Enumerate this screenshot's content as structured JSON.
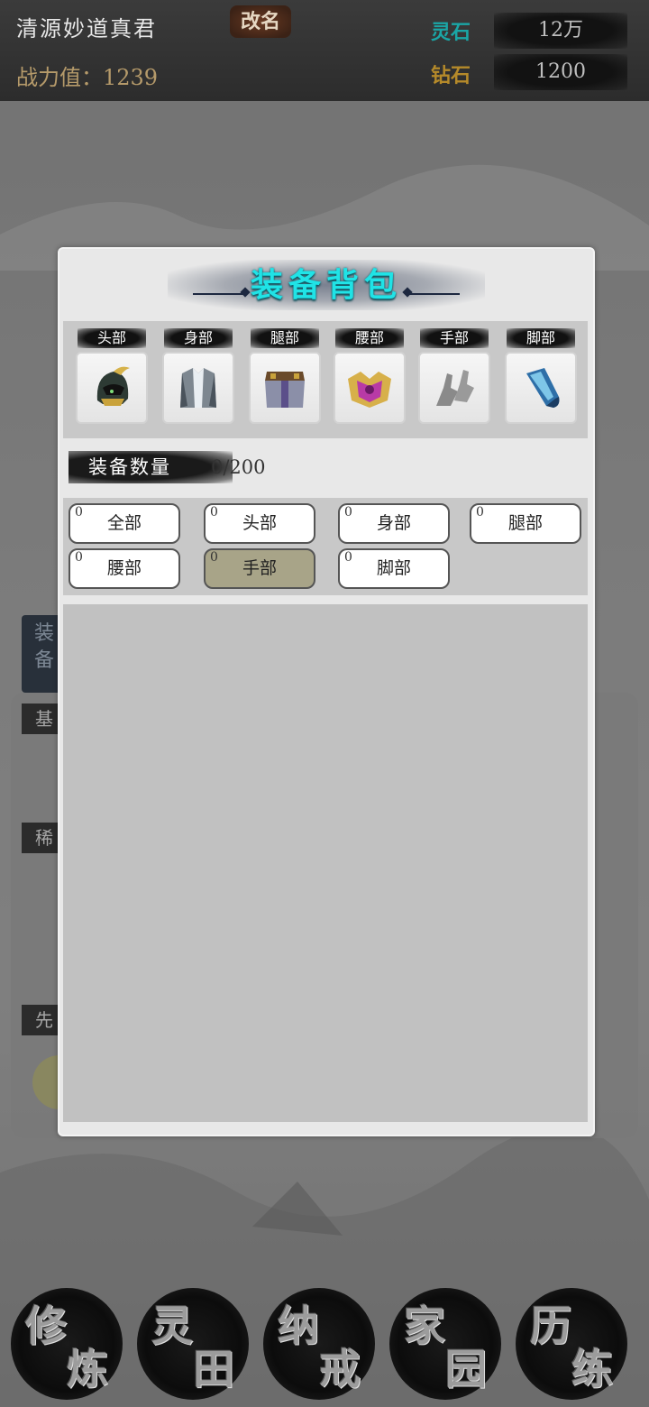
{
  "header": {
    "player_name": "清源妙道真君",
    "rename_label": "改名",
    "power_label": "战力值：1239",
    "lingshi_label": "灵石",
    "lingshi_value": "12万",
    "zuanshi_label": "钻石",
    "zuanshi_value": "1200",
    "lingshi_color": "#1aa6a6",
    "zuanshi_color": "#b58a2a"
  },
  "background": {
    "tab_partial": "装备",
    "section_1": "基",
    "section_2": "稀",
    "section_3": "先"
  },
  "modal": {
    "title": "装备背包",
    "slots": [
      {
        "label": "头部",
        "icon": "helmet-icon"
      },
      {
        "label": "身部",
        "icon": "armor-icon"
      },
      {
        "label": "腿部",
        "icon": "leg-armor-icon"
      },
      {
        "label": "腰部",
        "icon": "belt-icon"
      },
      {
        "label": "手部",
        "icon": "gloves-icon"
      },
      {
        "label": "脚部",
        "icon": "boots-icon"
      }
    ],
    "count_label": "装备数量",
    "count_value": "0/200",
    "filters": [
      {
        "label": "全部",
        "count": "0",
        "active": false
      },
      {
        "label": "头部",
        "count": "0",
        "active": false
      },
      {
        "label": "身部",
        "count": "0",
        "active": false
      },
      {
        "label": "腿部",
        "count": "0",
        "active": false
      },
      {
        "label": "腰部",
        "count": "0",
        "active": false
      },
      {
        "label": "手部",
        "count": "0",
        "active": true
      },
      {
        "label": "脚部",
        "count": "0",
        "active": false
      }
    ]
  },
  "nav": [
    {
      "top": "修",
      "bottom": "炼"
    },
    {
      "top": "灵",
      "bottom": "田"
    },
    {
      "top": "纳",
      "bottom": "戒"
    },
    {
      "top": "家",
      "bottom": "园"
    },
    {
      "top": "历",
      "bottom": "练"
    }
  ]
}
